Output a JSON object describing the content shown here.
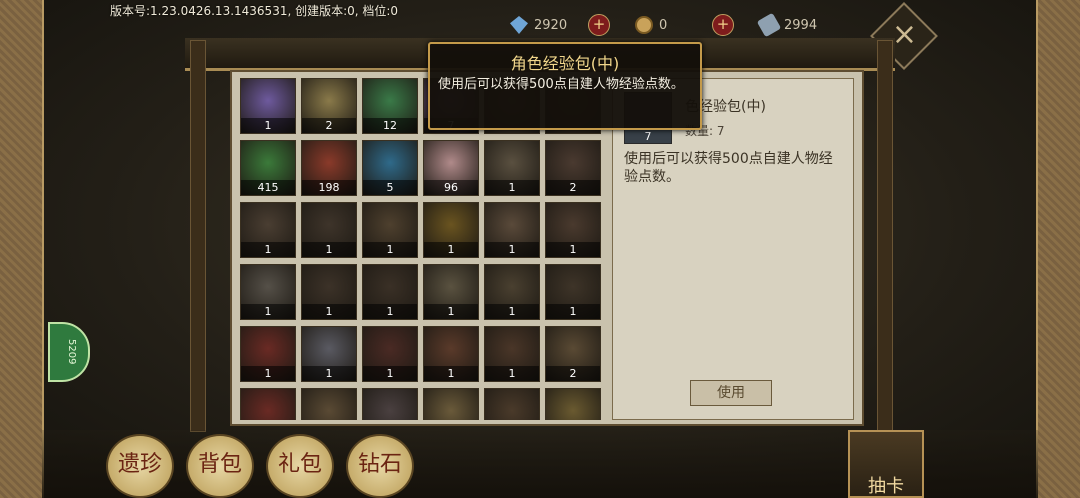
{
  "version_text": "版本号:1.23.0426.13.1436531, 创建版本:0, 档位:0",
  "resources": [
    {
      "name": "diamond",
      "value": "2920",
      "color": "#6fa5d6",
      "icon": "diamond-icon"
    },
    {
      "name": "coin",
      "value": "0",
      "color": "#c9a25a",
      "icon": "coin-icon"
    },
    {
      "name": "scroll",
      "value": "2994",
      "color": "#8ea0b0",
      "icon": "scroll-icon"
    }
  ],
  "tooltip": {
    "title": "角色经验包(中)",
    "desc": "使用后可以获得500点自建人物经验点数。"
  },
  "detail": {
    "title": "色经验包(中)",
    "count": "7",
    "qty": "数量: 7",
    "desc": "使用后可以获得500点自建人物经验点数。",
    "use_label": "使用"
  },
  "side_button": "5209",
  "items": [
    {
      "count": "1",
      "color": "#6e5a9e"
    },
    {
      "count": "2",
      "color": "#8a7a4a"
    },
    {
      "count": "12",
      "color": "#3a7a48"
    },
    {
      "count": "7",
      "color": "#7a5a8a"
    },
    {
      "count": "",
      "color": "#5a4a3a"
    },
    {
      "count": "",
      "color": "#4a3a2a"
    },
    {
      "count": "415",
      "color": "#3b7a3a"
    },
    {
      "count": "198",
      "color": "#8a3a2a"
    },
    {
      "count": "5",
      "color": "#2f6a8a"
    },
    {
      "count": "96",
      "color": "#b08a8a"
    },
    {
      "count": "1",
      "color": "#5a5040"
    },
    {
      "count": "2",
      "color": "#4a3a30"
    },
    {
      "count": "1",
      "color": "#4a3e32"
    },
    {
      "count": "1",
      "color": "#3e342a"
    },
    {
      "count": "1",
      "color": "#4e402e"
    },
    {
      "count": "1",
      "color": "#6a5420"
    },
    {
      "count": "1",
      "color": "#5a4a3a"
    },
    {
      "count": "1",
      "color": "#4a3a2e"
    },
    {
      "count": "1",
      "color": "#555048"
    },
    {
      "count": "1",
      "color": "#3c3228"
    },
    {
      "count": "1",
      "color": "#3a3026"
    },
    {
      "count": "1",
      "color": "#5a5240"
    },
    {
      "count": "1",
      "color": "#4a4030"
    },
    {
      "count": "1",
      "color": "#3e3428"
    },
    {
      "count": "1",
      "color": "#6a2a24"
    },
    {
      "count": "1",
      "color": "#5a5a62"
    },
    {
      "count": "1",
      "color": "#4a2a24"
    },
    {
      "count": "1",
      "color": "#5a3a2a"
    },
    {
      "count": "1",
      "color": "#4a3628"
    },
    {
      "count": "2",
      "color": "#5a4a34"
    },
    {
      "count": "",
      "color": "#6a2a24"
    },
    {
      "count": "",
      "color": "#5a4a34"
    },
    {
      "count": "",
      "color": "#4a4040"
    },
    {
      "count": "",
      "color": "#6a5a3a"
    },
    {
      "count": "",
      "color": "#4a3a2a"
    },
    {
      "count": "",
      "color": "#6a5a30"
    }
  ],
  "tabs": [
    "遗珍",
    "背包",
    "礼包",
    "钻石"
  ],
  "draw_label": "抽卡"
}
